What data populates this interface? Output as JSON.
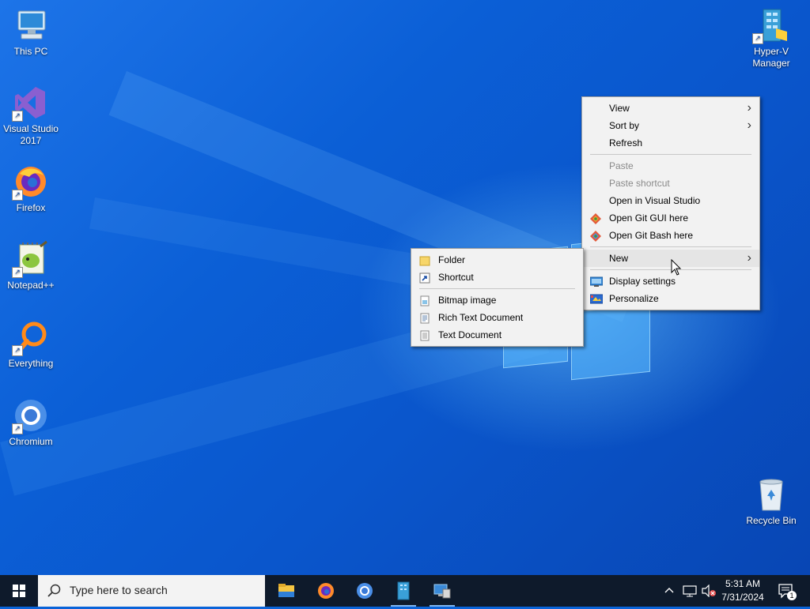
{
  "desktop": {
    "icons": [
      {
        "label": "This PC",
        "icon": "this-pc-icon"
      },
      {
        "label": "Visual Studio 2017",
        "icon": "visual-studio-icon"
      },
      {
        "label": "Firefox",
        "icon": "firefox-icon"
      },
      {
        "label": "Notepad++",
        "icon": "notepad-plus-plus-icon"
      },
      {
        "label": "Everything",
        "icon": "everything-search-icon"
      },
      {
        "label": "Chromium",
        "icon": "chromium-icon"
      },
      {
        "label": "Hyper-V Manager",
        "icon": "hyper-v-manager-icon"
      },
      {
        "label": "Recycle Bin",
        "icon": "recycle-bin-icon"
      }
    ]
  },
  "context_menu": {
    "items": [
      {
        "label": "View"
      },
      {
        "label": "Sort by"
      },
      {
        "label": "Refresh"
      },
      {
        "label": "Paste"
      },
      {
        "label": "Paste shortcut"
      },
      {
        "label": "Open in Visual Studio"
      },
      {
        "label": "Open Git GUI here"
      },
      {
        "label": "Open Git Bash here"
      },
      {
        "label": "New"
      },
      {
        "label": "Display settings"
      },
      {
        "label": "Personalize"
      }
    ],
    "submenu_arrow": "›"
  },
  "new_submenu": {
    "items": [
      {
        "label": "Folder"
      },
      {
        "label": "Shortcut"
      },
      {
        "label": "Bitmap image"
      },
      {
        "label": "Rich Text Document"
      },
      {
        "label": "Text Document"
      }
    ]
  },
  "taskbar": {
    "search_placeholder": "Type here to search",
    "time": "5:31 AM",
    "date": "7/31/2024",
    "notification_count": "1",
    "pinned_apps": [
      "file-explorer-icon",
      "firefox-icon",
      "chromium-icon",
      "hyper-v-manager-icon",
      "remote-desktop-icon"
    ]
  },
  "colors": {
    "accent": "#0a63d8",
    "taskbar": "#0e1a2b",
    "menu_bg": "#f2f2f2",
    "menu_highlight": "#e5e5e5"
  }
}
